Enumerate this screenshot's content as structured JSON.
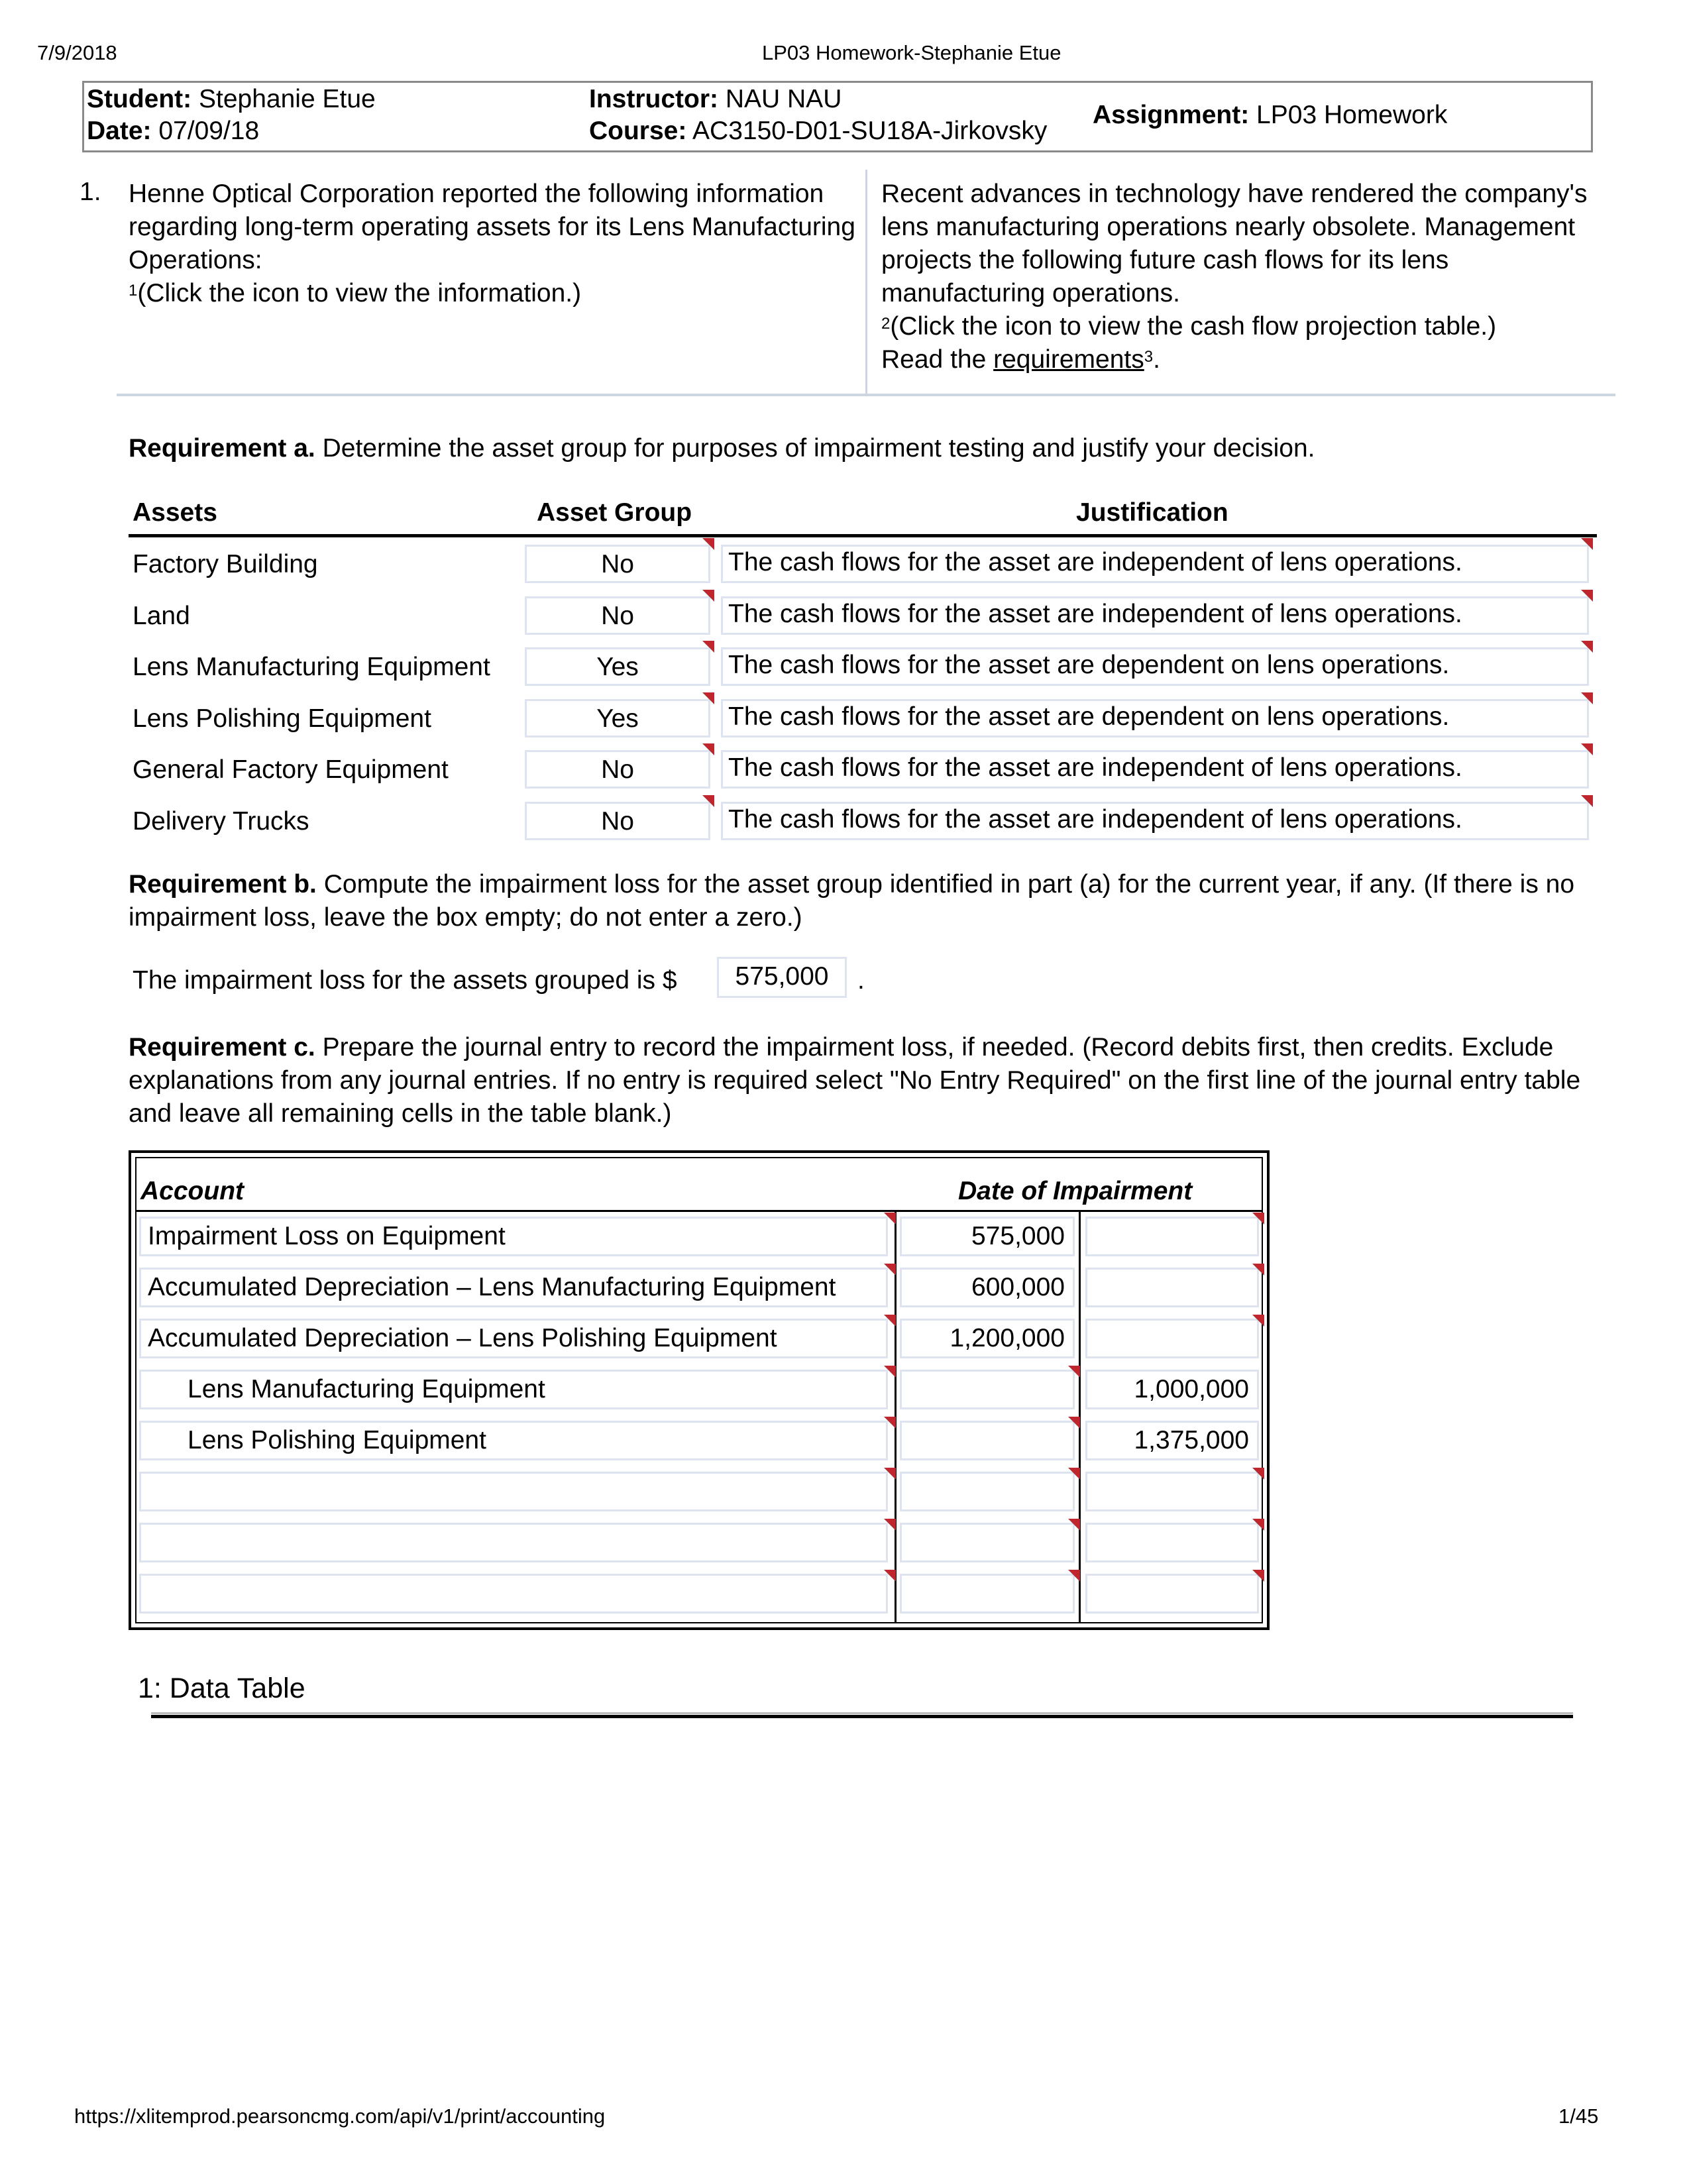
{
  "print_header": {
    "date": "7/9/2018",
    "title": "LP03 Homework-Stephanie Etue"
  },
  "info": {
    "student_label": "Student:",
    "student": "Stephanie Etue",
    "date_label": "Date:",
    "date": "07/09/18",
    "instructor_label": "Instructor:",
    "instructor": "NAU NAU",
    "course_label": "Course:",
    "course": "AC3150-D01-SU18A-Jirkovsky",
    "assignment_label": "Assignment:",
    "assignment": "LP03 Homework"
  },
  "question": {
    "number": "1.",
    "left_text": "Henne Optical Corporation reported the following information regarding long-term operating assets for its Lens Manufacturing Operations:",
    "left_note_sup": "1",
    "left_note": "(Click the icon to view the information.)",
    "right_text": "Recent advances in technology have rendered the company's lens manufacturing operations nearly obsolete. Management projects the following future cash flows for its lens manufacturing operations.",
    "right_note_sup": "2",
    "right_note": "(Click the icon to view the cash flow projection table.)",
    "read_prefix": "Read the ",
    "read_link": "requirements",
    "read_sup": "3",
    "read_suffix": "."
  },
  "req_a": {
    "label": "Requirement a.",
    "text": " Determine the asset group for purposes of impairment testing and justify your decision.",
    "headers": {
      "assets": "Assets",
      "group": "Asset Group",
      "justification": "Justification"
    },
    "rows": [
      {
        "asset": "Factory Building",
        "group": "No",
        "justification": "The cash flows for the asset are independent of lens operations."
      },
      {
        "asset": "Land",
        "group": "No",
        "justification": "The cash flows for the asset are independent of lens operations."
      },
      {
        "asset": "Lens Manufacturing Equipment",
        "group": "Yes",
        "justification": "The cash flows for the asset are dependent on lens operations."
      },
      {
        "asset": "Lens Polishing Equipment",
        "group": "Yes",
        "justification": "The cash flows for the asset are dependent on lens operations."
      },
      {
        "asset": "General Factory Equipment",
        "group": "No",
        "justification": "The cash flows for the asset are independent of lens operations."
      },
      {
        "asset": "Delivery Trucks",
        "group": "No",
        "justification": "The cash flows for the asset are independent of lens operations."
      }
    ]
  },
  "req_b": {
    "label": "Requirement b.",
    "text": " Compute the impairment loss for the asset group identified in part (a) for the current year, if any. (If there is no impairment loss, leave the box empty; do not enter a zero.)",
    "answer_prefix": "The impairment loss for the assets grouped is $",
    "answer_value": "575,000",
    "answer_suffix": "."
  },
  "req_c": {
    "label": "Requirement c.",
    "text": " Prepare the journal entry to record the impairment loss, if needed. (Record debits first, then credits. Exclude explanations from any journal entries. If no entry is required select \"No Entry Required\" on the first line of the journal entry table and leave all remaining cells in the table blank.)",
    "headers": {
      "account": "Account",
      "date": "Date of Impairment"
    },
    "rows": [
      {
        "account": "Impairment Loss on Equipment",
        "debit": "575,000",
        "credit": "",
        "indent": false
      },
      {
        "account": "Accumulated Depreciation – Lens Manufacturing Equipment",
        "debit": "600,000",
        "credit": "",
        "indent": false
      },
      {
        "account": "Accumulated Depreciation – Lens Polishing Equipment",
        "debit": "1,200,000",
        "credit": "",
        "indent": false
      },
      {
        "account": "Lens Manufacturing Equipment",
        "debit": "",
        "credit": "1,000,000",
        "indent": true
      },
      {
        "account": "Lens Polishing Equipment",
        "debit": "",
        "credit": "1,375,000",
        "indent": true
      },
      {
        "account": "",
        "debit": "",
        "credit": "",
        "indent": false
      },
      {
        "account": "",
        "debit": "",
        "credit": "",
        "indent": false
      },
      {
        "account": "",
        "debit": "",
        "credit": "",
        "indent": false
      }
    ]
  },
  "data_table": {
    "title": "1: Data Table"
  },
  "footer": {
    "url": "https://xlitemprod.pearsoncmg.com/api/v1/print/accounting",
    "page": "1/45"
  },
  "colors": {
    "field_border": "#dde4ef",
    "marker": "#c0262d",
    "divider": "#cdd5e1"
  }
}
